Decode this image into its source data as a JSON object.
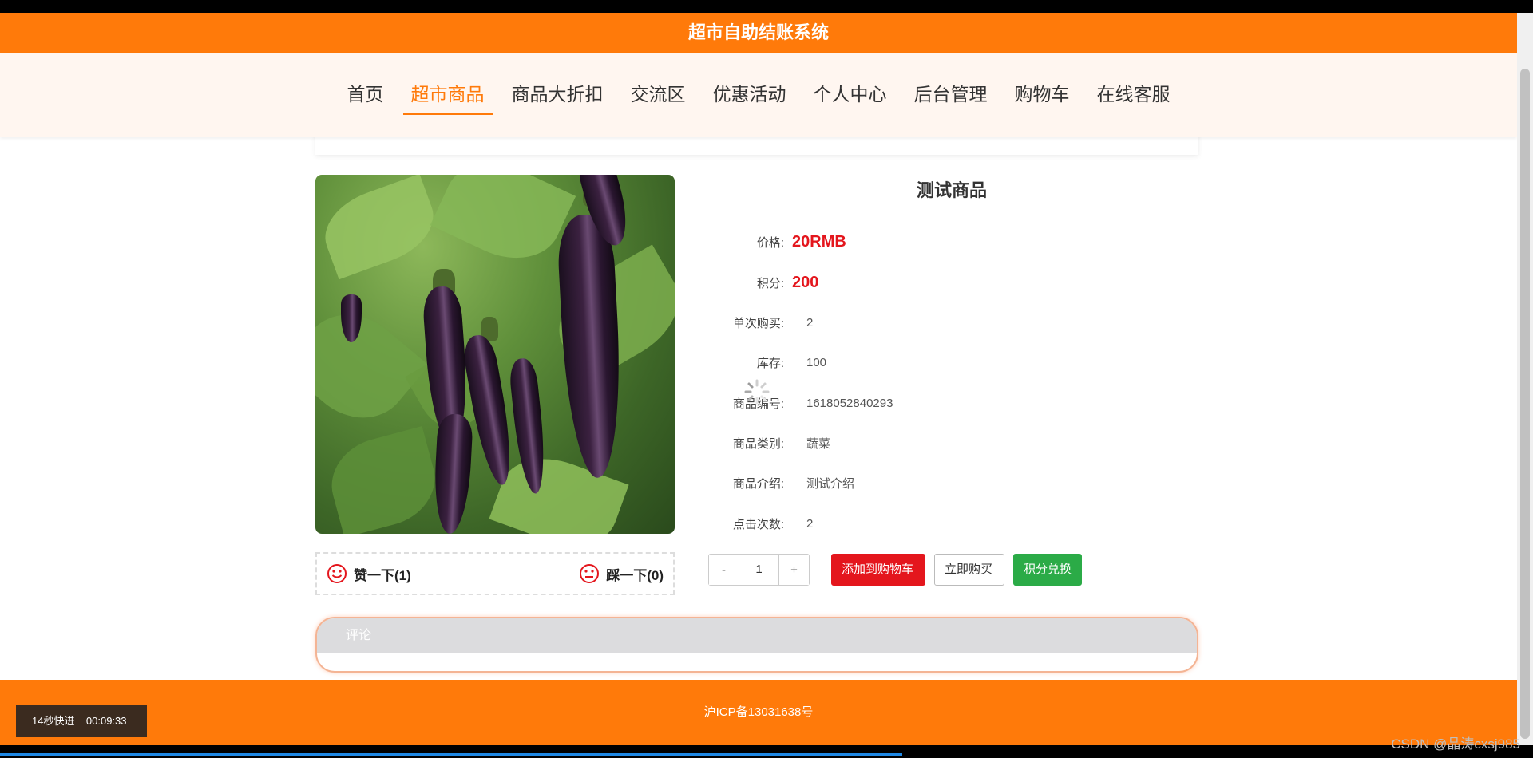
{
  "header": {
    "title": "超市自助结账系统"
  },
  "nav": {
    "items": [
      "首页",
      "超市商品",
      "商品大折扣",
      "交流区",
      "优惠活动",
      "个人中心",
      "后台管理",
      "购物车",
      "在线客服"
    ],
    "active_index": 1
  },
  "product": {
    "title": "测试商品",
    "price_label": "价格:",
    "price_value": "20RMB",
    "points_label": "积分:",
    "points_value": "200",
    "single_purchase_label": "单次购买:",
    "single_purchase_value": "2",
    "stock_label": "库存:",
    "stock_value": "100",
    "code_label": "商品编号:",
    "code_value": "1618052840293",
    "category_label": "商品类别:",
    "category_value": "蔬菜",
    "intro_label": "商品介绍:",
    "intro_value": "测试介绍",
    "clicks_label": "点击次数:",
    "clicks_value": "2"
  },
  "vote": {
    "like_label": "赞一下(1)",
    "dislike_label": "踩一下(0)"
  },
  "quantity": {
    "minus": "-",
    "value": "1",
    "plus": "+"
  },
  "actions": {
    "add_to_cart": "添加到购物车",
    "buy_now": "立即购买",
    "redeem": "积分兑换"
  },
  "comment": {
    "title": "评论"
  },
  "footer": {
    "icp": "沪ICP备13031638号"
  },
  "overlay": {
    "video_badge": "14秒快进    00:09:33",
    "watermark": "CSDN @晶涛cxsj985"
  },
  "colors": {
    "brand": "#ff7a0a",
    "price": "#e4161d",
    "redeem": "#2bab47"
  }
}
